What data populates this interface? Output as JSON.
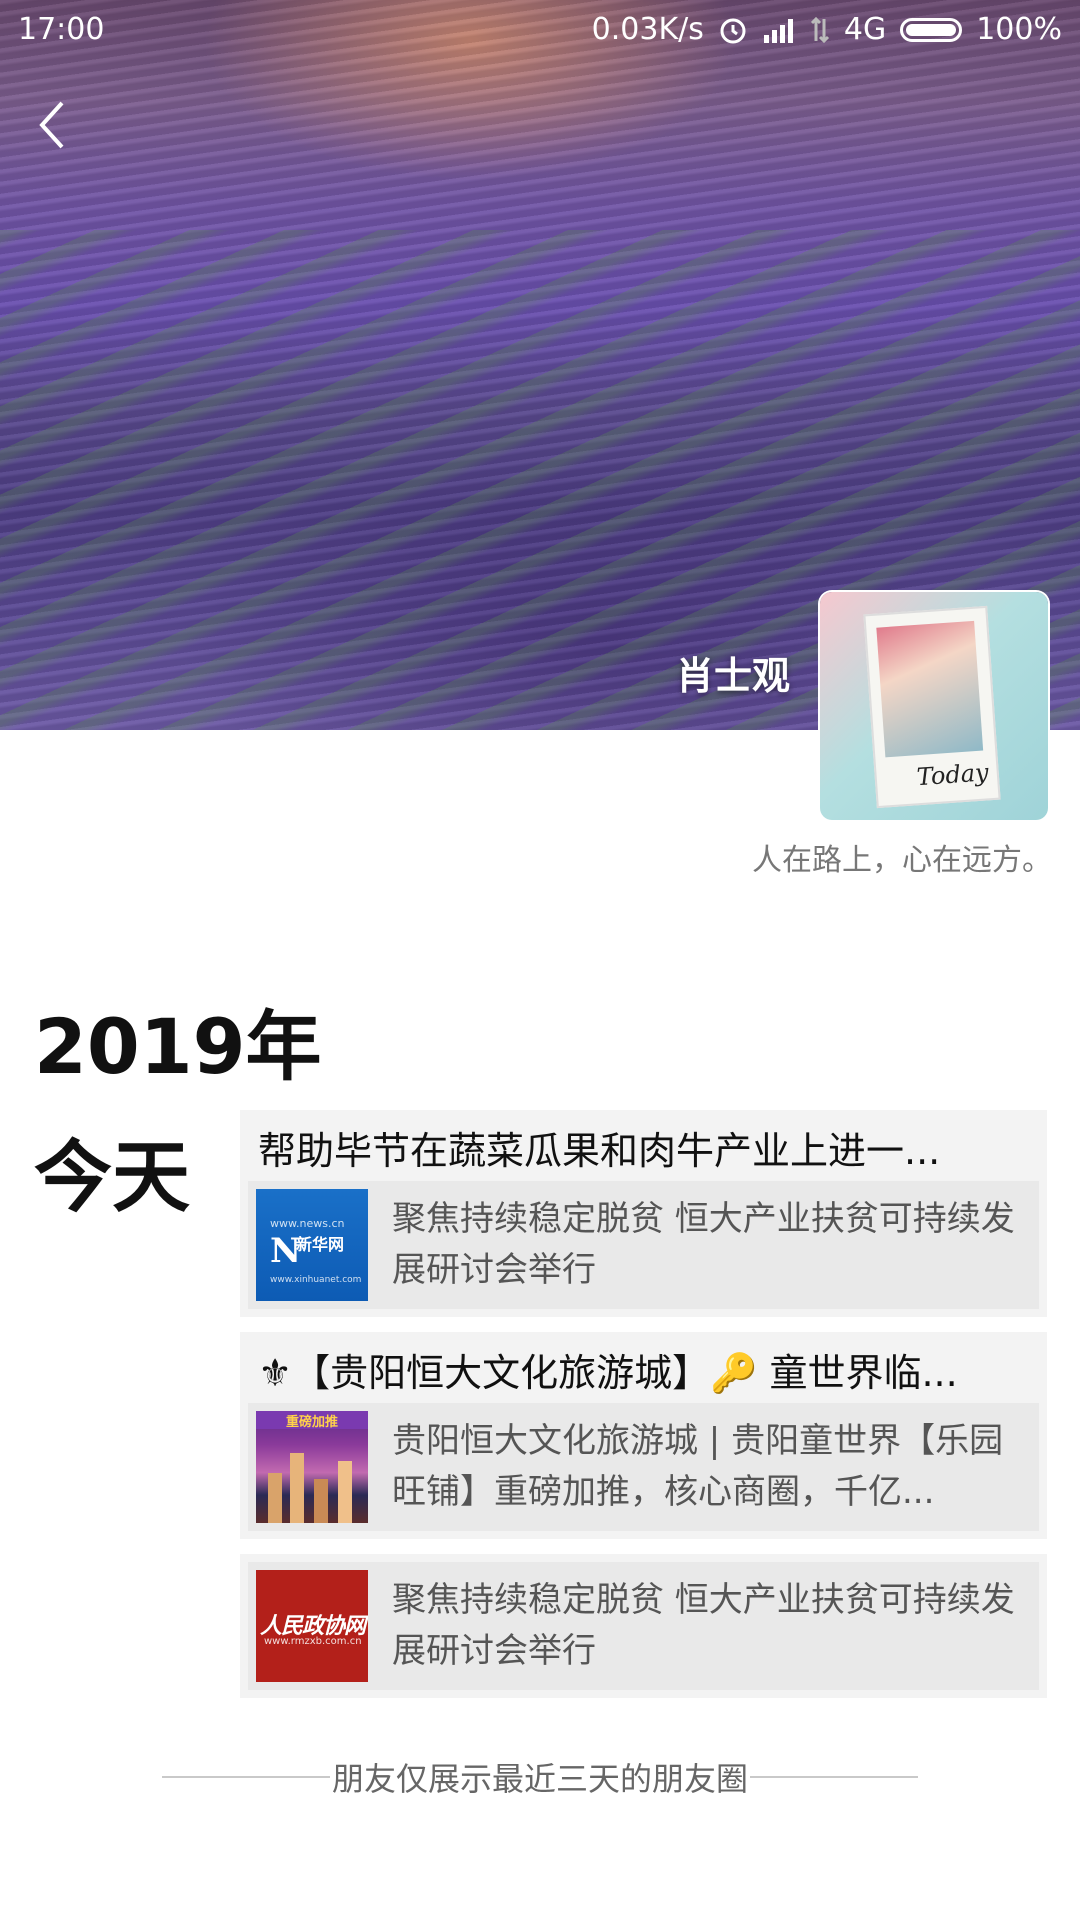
{
  "status_bar": {
    "time": "17:00",
    "network_speed": "0.03K/s",
    "signal_label": "4G",
    "battery": "100%"
  },
  "header": {
    "back_icon": "chevron-left-icon",
    "profile_name": "肖士观",
    "signature": "人在路上，心在远方。"
  },
  "timeline": {
    "year": "2019年",
    "day": "今天",
    "posts": [
      {
        "title": "帮助毕节在蔬菜瓜果和肉牛产业上进一...",
        "link_text": "聚焦持续稳定脱贫 恒大产业扶贫可持续发展研讨会举行",
        "thumb": "xinhua-news-logo",
        "thumb_lines": [
          "www.news.cn",
          "N",
          "新华网",
          "www.xinhuanet.com"
        ]
      },
      {
        "title": "⚜【贵阳恒大文化旅游城】🔑 童世界临...",
        "link_text": "贵阳恒大文化旅游城 | 贵阳童世界【乐园旺铺】重磅加推，核心商圈，千亿...",
        "thumb": "city-night-promo",
        "thumb_lines": [
          "重磅加推"
        ]
      },
      {
        "title": "",
        "link_text": "聚焦持续稳定脱贫 恒大产业扶贫可持续发展研讨会举行",
        "thumb": "rmzx-logo",
        "thumb_lines": [
          "人民政协网",
          "www.rmzxb.com.cn"
        ]
      }
    ]
  },
  "footer": {
    "text": "朋友仅展示最近三天的朋友圈"
  },
  "colors": {
    "cover_purple": "#6a50b0",
    "card_bg": "#f3f3f3",
    "link_bg": "#e9e9e9"
  }
}
